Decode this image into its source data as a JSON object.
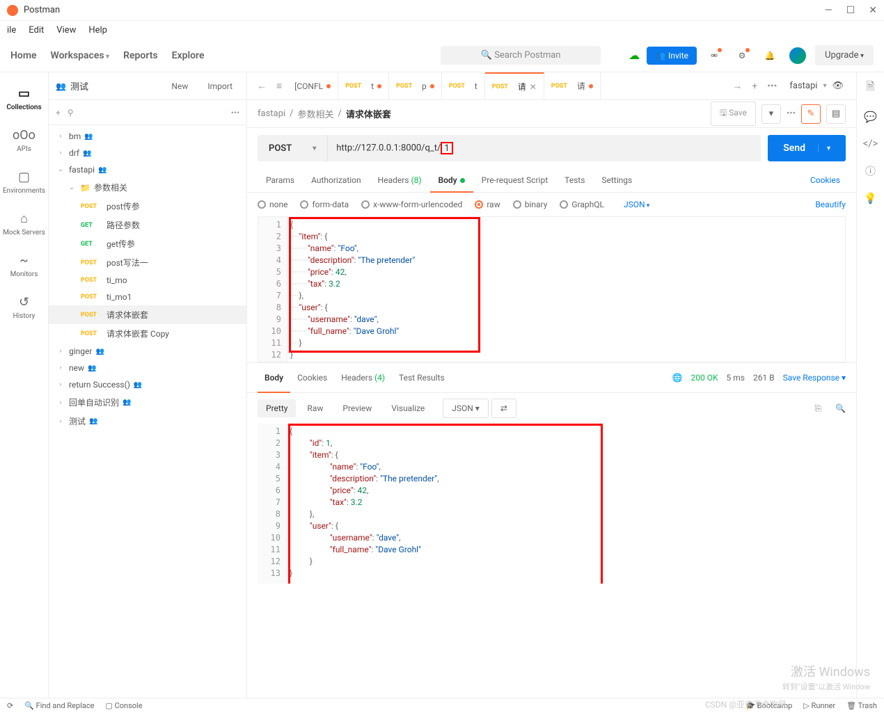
{
  "app": {
    "title": "Postman"
  },
  "menu": [
    "ile",
    "Edit",
    "View",
    "Help"
  ],
  "nav": {
    "home": "Home",
    "workspaces": "Workspaces",
    "reports": "Reports",
    "explore": "Explore"
  },
  "search": {
    "placeholder": "Search Postman"
  },
  "invite": "Invite",
  "upgrade": "Upgrade",
  "workspace": "测试",
  "sb_actions": {
    "new": "New",
    "import": "Import"
  },
  "rail": [
    {
      "icon": "▭",
      "label": "Collections",
      "active": true
    },
    {
      "icon": "oOo",
      "label": "APIs"
    },
    {
      "icon": "▢",
      "label": "Environments"
    },
    {
      "icon": "⌂",
      "label": "Mock Servers"
    },
    {
      "icon": "~",
      "label": "Monitors"
    },
    {
      "icon": "↺",
      "label": "History"
    }
  ],
  "tree": [
    {
      "lvl": 1,
      "chev": "›",
      "label": "bm",
      "p": true
    },
    {
      "lvl": 1,
      "chev": "›",
      "label": "drf",
      "p": true
    },
    {
      "lvl": 1,
      "chev": "⌄",
      "label": "fastapi",
      "p": true
    },
    {
      "lvl": 2,
      "chev": "⌄",
      "fold": true,
      "label": "参数相关"
    },
    {
      "lvl": 3,
      "method": "POST",
      "mc": "post",
      "label": "post传参"
    },
    {
      "lvl": 3,
      "method": "GET",
      "mc": "get",
      "label": "路径参数"
    },
    {
      "lvl": 3,
      "method": "GET",
      "mc": "get",
      "label": "get传参"
    },
    {
      "lvl": 3,
      "method": "POST",
      "mc": "post",
      "label": "post写法一"
    },
    {
      "lvl": 3,
      "method": "POST",
      "mc": "post",
      "label": "ti_mo"
    },
    {
      "lvl": 3,
      "method": "POST",
      "mc": "post",
      "label": "ti_mo1"
    },
    {
      "lvl": 3,
      "method": "POST",
      "mc": "post",
      "label": "请求体嵌套",
      "sel": true
    },
    {
      "lvl": 3,
      "method": "POST",
      "mc": "post",
      "label": "请求体嵌套 Copy"
    },
    {
      "lvl": 1,
      "chev": "›",
      "label": "ginger",
      "p": true
    },
    {
      "lvl": 1,
      "chev": "›",
      "label": "new",
      "p": true
    },
    {
      "lvl": 1,
      "chev": "›",
      "label": "return Success()",
      "p": true
    },
    {
      "lvl": 1,
      "chev": "›",
      "label": "回单自动识别",
      "p": true
    },
    {
      "lvl": 1,
      "chev": "›",
      "label": "测试",
      "p": true
    }
  ],
  "tabs": [
    {
      "label": "[CONFL",
      "dot": true
    },
    {
      "method": "POST",
      "label": "t",
      "dot": true
    },
    {
      "method": "POST",
      "label": "p",
      "dot": true
    },
    {
      "method": "POST",
      "label": "t"
    },
    {
      "method": "POST",
      "label": "请",
      "active": true,
      "close": true
    },
    {
      "method": "POST",
      "label": "请",
      "dot": true
    }
  ],
  "env": "fastapi",
  "crumbs": {
    "a": "fastapi",
    "b": "参数相关",
    "c": "请求体嵌套"
  },
  "save": "Save",
  "request": {
    "method": "POST",
    "url": "http://127.0.0.1:8000/q_t/",
    "url_suffix": "1"
  },
  "send": "Send",
  "reqtabs": {
    "params": "Params",
    "auth": "Authorization",
    "headers": "Headers",
    "hcount": "(8)",
    "body": "Body",
    "pre": "Pre-request Script",
    "tests": "Tests",
    "settings": "Settings",
    "cookies": "Cookies"
  },
  "bodytypes": {
    "none": "none",
    "form": "form-data",
    "xwww": "x-www-form-urlencoded",
    "raw": "raw",
    "binary": "binary",
    "graphql": "GraphQL",
    "json": "JSON",
    "beautify": "Beautify"
  },
  "req_body_lines": [
    "1",
    "2",
    "3",
    "4",
    "5",
    "6",
    "7",
    "8",
    "9",
    "10",
    "11",
    "12"
  ],
  "req_body": {
    "item": {
      "name": "Foo",
      "description": "The pretender",
      "price": 42.0,
      "tax": 3.2
    },
    "user": {
      "username": "dave",
      "full_name": "Dave Grohl"
    }
  },
  "resp": {
    "tabs": {
      "body": "Body",
      "cookies": "Cookies",
      "headers": "Headers",
      "hcount": "(4)",
      "test": "Test Results"
    },
    "status": {
      "code": "200 OK",
      "time": "5 ms",
      "size": "261 B"
    },
    "save": "Save Response",
    "views": {
      "pretty": "Pretty",
      "raw": "Raw",
      "preview": "Preview",
      "visualize": "Visualize",
      "json": "JSON"
    },
    "lines": [
      "1",
      "2",
      "3",
      "4",
      "5",
      "6",
      "7",
      "8",
      "9",
      "10",
      "11",
      "12",
      "13"
    ],
    "data": {
      "id": 1,
      "item": {
        "name": "Foo",
        "description": "The pretender",
        "price": 42.0,
        "tax": 3.2
      },
      "user": {
        "username": "dave",
        "full_name": "Dave Grohl"
      }
    }
  },
  "statusbar": {
    "find": "Find and Replace",
    "console": "Console",
    "bootcamp": "Bootcamp",
    "runner": "Runner",
    "trash": "Trash"
  },
  "watermark": {
    "l1": "激活 Windows",
    "l2": "转到\"设置\"以激活 Window"
  },
  "csdn": "CSDN @亚索不会吹风"
}
